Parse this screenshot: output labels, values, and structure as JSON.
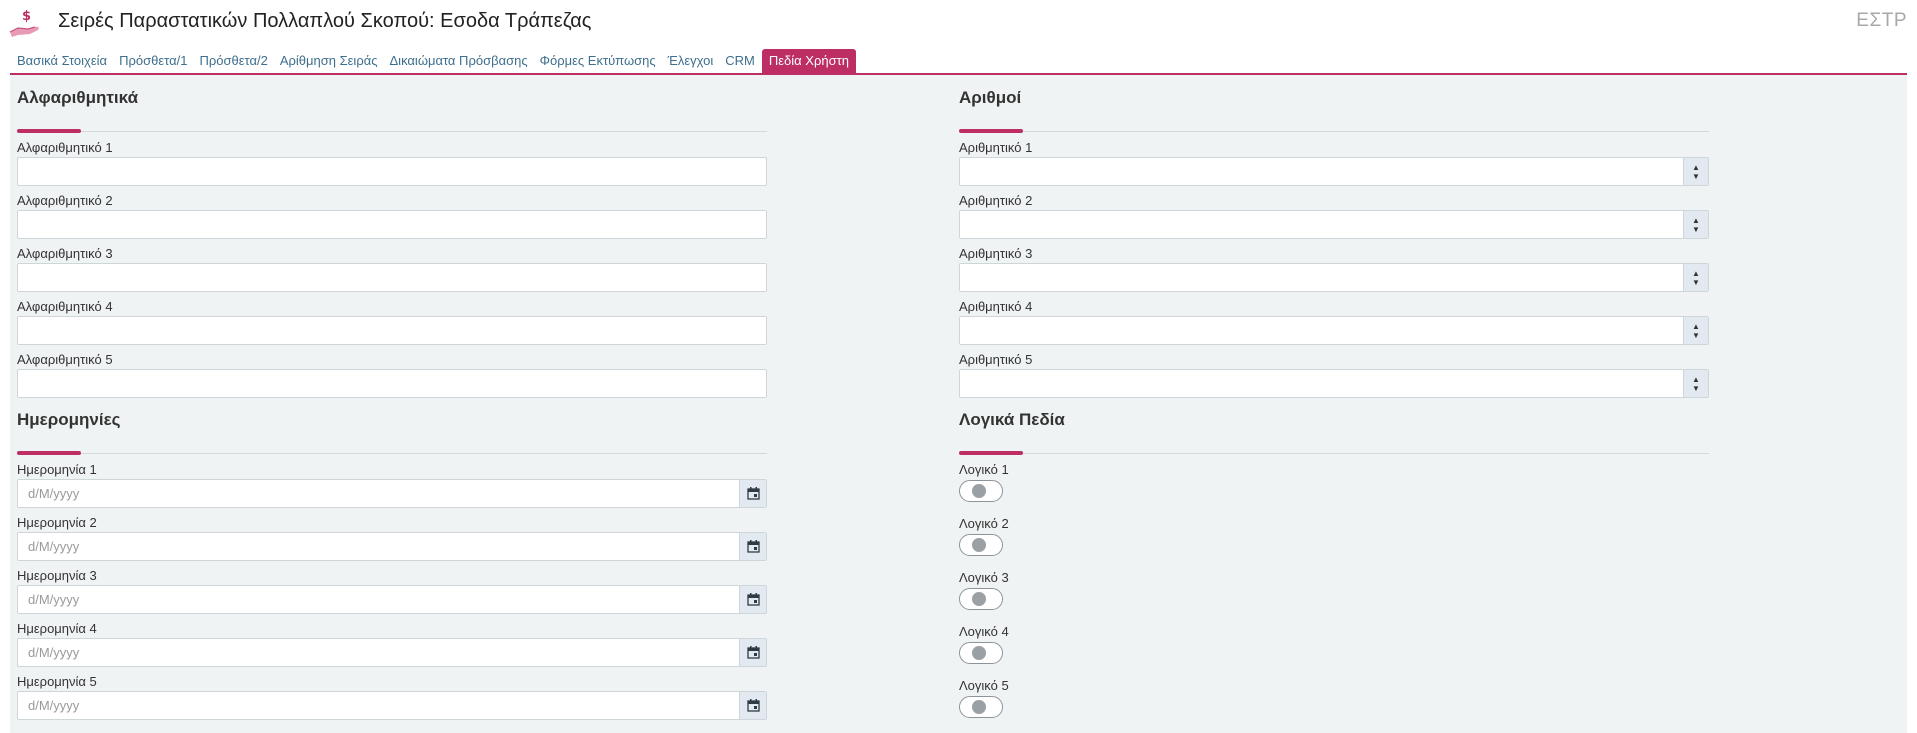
{
  "header": {
    "title": "Σειρές Παραστατικών Πολλαπλού Σκοπού: Εσοδα Τράπεζας",
    "code": "ΕΣΤΡ",
    "logo_icon": "money-hand-icon"
  },
  "tabs": [
    {
      "label": "Βασικά Στοιχεία",
      "active": false
    },
    {
      "label": "Πρόσθετα/1",
      "active": false
    },
    {
      "label": "Πρόσθετα/2",
      "active": false
    },
    {
      "label": "Αρίθμηση Σειράς",
      "active": false
    },
    {
      "label": "Δικαιώματα Πρόσβασης",
      "active": false
    },
    {
      "label": "Φόρμες Εκτύπωσης",
      "active": false
    },
    {
      "label": "Έλεγχοι",
      "active": false
    },
    {
      "label": "CRM",
      "active": false
    },
    {
      "label": "Πεδία Χρήστη",
      "active": true
    }
  ],
  "colors": {
    "accent": "#bd2f64",
    "tab_text": "#3f6f8e",
    "panel_bg": "#f0f3f4"
  },
  "alphanumeric": {
    "title": "Αλφαριθμητικά",
    "fields": [
      {
        "label": "Αλφαριθμητικό 1",
        "value": ""
      },
      {
        "label": "Αλφαριθμητικό 2",
        "value": ""
      },
      {
        "label": "Αλφαριθμητικό 3",
        "value": ""
      },
      {
        "label": "Αλφαριθμητικό 4",
        "value": ""
      },
      {
        "label": "Αλφαριθμητικό 5",
        "value": ""
      }
    ]
  },
  "numbers": {
    "title": "Αριθμοί",
    "fields": [
      {
        "label": "Αριθμητικό 1",
        "value": ""
      },
      {
        "label": "Αριθμητικό 2",
        "value": ""
      },
      {
        "label": "Αριθμητικό 3",
        "value": ""
      },
      {
        "label": "Αριθμητικό 4",
        "value": ""
      },
      {
        "label": "Αριθμητικό 5",
        "value": ""
      }
    ]
  },
  "dates": {
    "title": "Ημερομηνίες",
    "fields": [
      {
        "label": "Ημερομηνία 1",
        "placeholder": "d/M/yyyy",
        "value": ""
      },
      {
        "label": "Ημερομηνία 2",
        "placeholder": "d/M/yyyy",
        "value": ""
      },
      {
        "label": "Ημερομηνία 3",
        "placeholder": "d/M/yyyy",
        "value": ""
      },
      {
        "label": "Ημερομηνία 4",
        "placeholder": "d/M/yyyy",
        "value": ""
      },
      {
        "label": "Ημερομηνία 5",
        "placeholder": "d/M/yyyy",
        "value": ""
      }
    ]
  },
  "logical": {
    "title": "Λογικά Πεδία",
    "fields": [
      {
        "label": "Λογικό 1",
        "checked": false
      },
      {
        "label": "Λογικό 2",
        "checked": false
      },
      {
        "label": "Λογικό 3",
        "checked": false
      },
      {
        "label": "Λογικό 4",
        "checked": false
      },
      {
        "label": "Λογικό 5",
        "checked": false
      }
    ]
  }
}
